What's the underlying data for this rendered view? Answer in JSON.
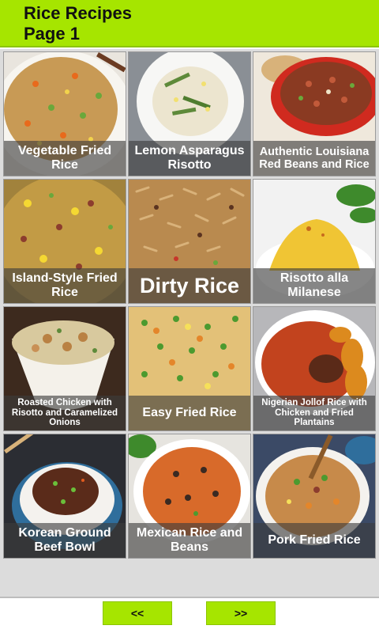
{
  "header": {
    "title_line1": "Rice Recipes",
    "title_line2": "Page 1",
    "accent_color": "#a6e500"
  },
  "recipes": [
    {
      "label": "Vegetable Fried Rice"
    },
    {
      "label": "Lemon Asparagus Risotto"
    },
    {
      "label": "Authentic Louisiana Red Beans and Rice"
    },
    {
      "label": "Island-Style Fried Rice"
    },
    {
      "label": "Dirty Rice"
    },
    {
      "label": "Risotto alla Milanese"
    },
    {
      "label": "Roasted Chicken with Risotto and Caramelized Onions"
    },
    {
      "label": "Easy Fried Rice"
    },
    {
      "label": "Nigerian Jollof Rice with Chicken and Fried Plantains"
    },
    {
      "label": "Korean Ground Beef Bowl"
    },
    {
      "label": "Mexican Rice and Beans"
    },
    {
      "label": "Pork Fried Rice"
    }
  ],
  "pagination": {
    "prev_label": "<<",
    "next_label": ">>"
  }
}
